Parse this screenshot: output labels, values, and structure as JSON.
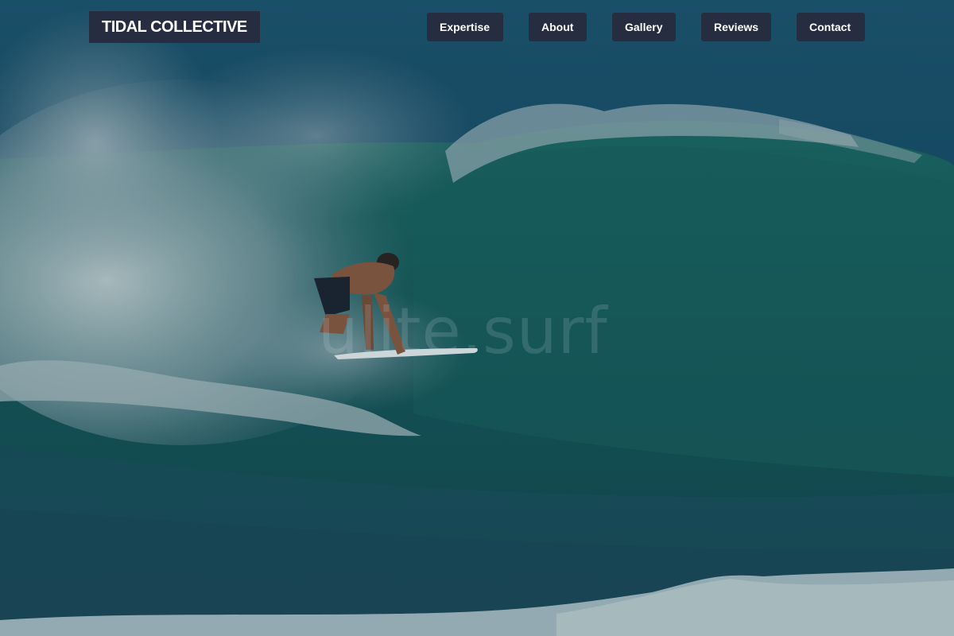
{
  "header": {
    "logo_text": "TIDAL COLLECTIVE"
  },
  "nav": {
    "items": [
      {
        "label": "Expertise"
      },
      {
        "label": "About"
      },
      {
        "label": "Gallery"
      },
      {
        "label": "Reviews"
      },
      {
        "label": "Contact"
      }
    ]
  },
  "hero": {
    "image_subject": "surfer riding inside a breaking ocean wave",
    "watermark_text": "ulite.surf"
  },
  "colors": {
    "nav_background": "#262d40",
    "nav_text": "#ffffff",
    "ocean_dark": "#0f3a48",
    "wave_face": "#1a5a5a",
    "spray": "#b8c8cc"
  }
}
